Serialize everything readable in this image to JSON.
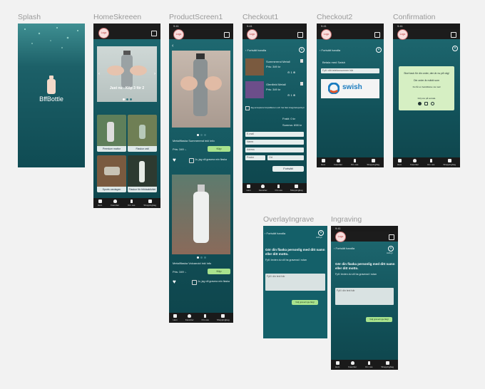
{
  "frames": {
    "splash": "Splash",
    "home": "HomeSkreeen",
    "product": "ProductScreen1",
    "checkout1": "Checkout1",
    "checkout2": "Checkout2",
    "confirmation": "Confirmation",
    "overlay": "OverlayIngrave",
    "ingraving": "Ingraving"
  },
  "app": {
    "brand": "BffBottle",
    "logo": "Logo",
    "time": "9:41"
  },
  "tabs": [
    "Hem",
    "Favoriter",
    "Om oss",
    "Shoppingbag"
  ],
  "home": {
    "hero": "Just nu - Köp 3 för 2",
    "cards": [
      "Premium mattor",
      "Flaskor vatt",
      "Sports vardagen",
      "Flaskor för fritidsaktivitet"
    ]
  },
  "product": {
    "p1": {
      "name": "Metallflaska Summerend inkl info",
      "price": "Pris: 349 :-",
      "add": "Köp",
      "engrave": "Jo, jag vill gravera min flaska"
    },
    "p2": {
      "name": "Metallflaska Volcanoid inkl info",
      "price": "Pris: 349 :-",
      "add": "Köp",
      "engrave": "Jo, jag vill gravera min flaska"
    }
  },
  "checkout1": {
    "back": "Fortsätt handla",
    "items": [
      {
        "name": "Summerend Metall",
        "price": "Pris: 349 kr",
        "qty": "1"
      },
      {
        "name": "Glenfield Metall",
        "price": "Pris: 349 kr",
        "qty": "1"
      }
    ],
    "terms": "Jag accepterar köpvillkoren och har läst integritetspolicyn",
    "freight": "Frakt: 0 kr",
    "total": "Summa: 698 kr",
    "fields": [
      "E-mail",
      "Namn",
      "Adress",
      "Postnr",
      "Ort"
    ],
    "continue": "Fortsätt"
  },
  "checkout2": {
    "back": "Fortsätt handla",
    "label": "Betala med Swish",
    "phone": "Fyll i ditt telefonnummer här",
    "swish": "swish"
  },
  "confirmation": {
    "lines": [
      "Stort tack för din order, den är nu på väg!",
      "Din order är märkt som",
      "Du får en bekräftelse via mail"
    ],
    "follow": "Följ oss på sociala"
  },
  "engrave": {
    "back": "Fortsätt handla",
    "cancel": "Avbryt",
    "title": "Gör din flaska personlig med ditt namn eller ditt motto.",
    "hint": "Fyll i texten du vill ha graverad i rutan",
    "field": "Fyll i din text här",
    "button": "Välj graverings-färgl"
  },
  "colors": {
    "teal": "#1f6a72",
    "green": "#a8e28d",
    "dark": "#1c1c1c",
    "swish": "#1a7bbf"
  }
}
